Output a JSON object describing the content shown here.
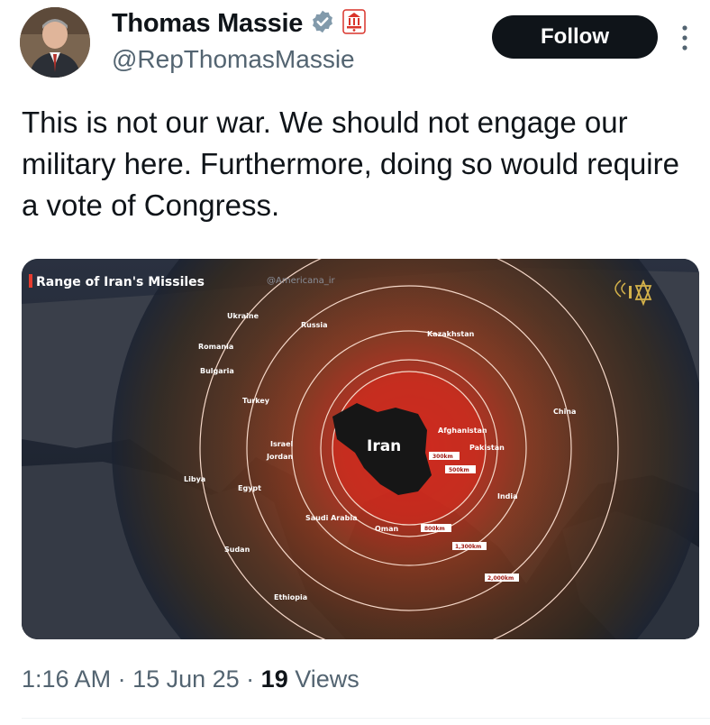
{
  "author": {
    "name": "Thomas Massie",
    "handle": "@RepThomasMassie"
  },
  "follow_label": "Follow",
  "tweet_text": "This is not our war. We should not engage our military here. Furthermore, doing so would require a vote of Congress.",
  "map": {
    "title": "Range of Iran's Missiles",
    "watermark": "@Americana_ir",
    "center_label": "Iran",
    "countries": [
      "Ukraine",
      "Russia",
      "Kazakhstan",
      "Romania",
      "Bulgaria",
      "Turkey",
      "China",
      "Afghanistan",
      "Pakistan",
      "Israel",
      "Jordan",
      "Libya",
      "Egypt",
      "India",
      "Saudi Arabia",
      "Oman",
      "Sudan",
      "Ethiopia"
    ],
    "ranges": [
      "300km",
      "500km",
      "800km",
      "1,300km",
      "2,000km"
    ]
  },
  "meta": {
    "time": "1:16 AM",
    "sep1": " · ",
    "date": "15 Jun 25",
    "sep2": " · ",
    "views_count": "19",
    "views_label": " Views"
  },
  "icons": {
    "verified": "verified-badge-icon",
    "affiliation": "government-affiliation-icon",
    "more": "more-options-icon"
  },
  "colors": {
    "verified": "#829aab",
    "affiliation_badge": "#d9342b",
    "follow_bg": "#0f1419",
    "meta_text": "#536471",
    "map_title_accent": "#e63b2e"
  }
}
